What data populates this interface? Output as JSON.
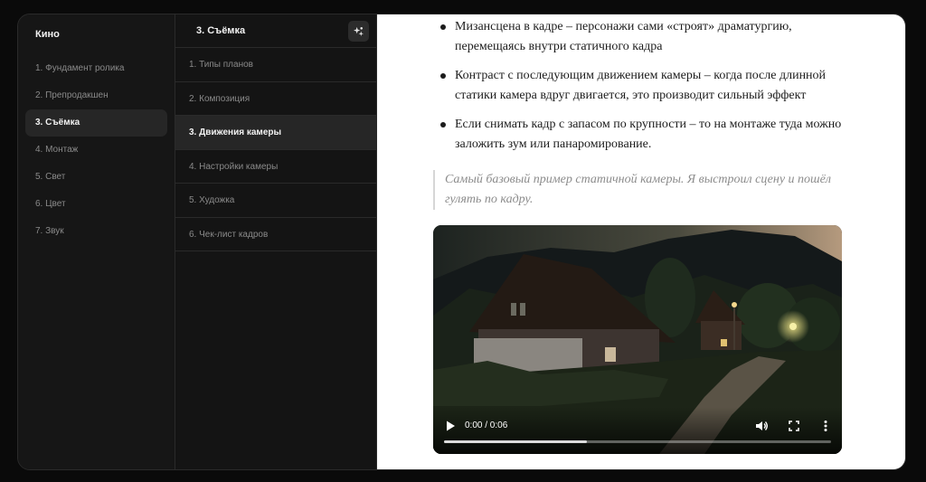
{
  "sidebar": {
    "title": "Кино",
    "items": [
      {
        "label": "1. Фундамент ролика",
        "active": false
      },
      {
        "label": "2. Препродакшен",
        "active": false
      },
      {
        "label": "3. Съёмка",
        "active": true
      },
      {
        "label": "4. Монтаж",
        "active": false
      },
      {
        "label": "5. Свет",
        "active": false
      },
      {
        "label": "6. Цвет",
        "active": false
      },
      {
        "label": "7. Звук",
        "active": false
      }
    ]
  },
  "chapters": {
    "title": "3. Съёмка",
    "header_icon": "sparkle-icon",
    "items": [
      {
        "label": "1. Типы планов",
        "active": false
      },
      {
        "label": "2. Композиция",
        "active": false
      },
      {
        "label": "3. Движения камеры",
        "active": true
      },
      {
        "label": "4. Настройки камеры",
        "active": false
      },
      {
        "label": "5. Художка",
        "active": false
      },
      {
        "label": "6. Чек-лист кадров",
        "active": false
      }
    ]
  },
  "content": {
    "bullets": [
      "Мизансцена в кадре – персонажи сами «строят» драматургию, перемещаясь внутри статичного кадра",
      "Контраст с последующим движением камеры – когда после длинной статики камера вдруг двигается, это производит сильный эффект",
      "Если снимать кадр с запасом по крупности – то на монтаже туда можно заложить зум или панаромирование."
    ],
    "quote": "Самый базовый пример статичной камеры. Я выстроил сцену и пошёл гулять по кадру.",
    "video": {
      "time": "0:00 / 0:06",
      "progress": 0.37
    }
  },
  "colors": {
    "background": "#0a0a0a",
    "panel": "#161616",
    "active_item": "#262626",
    "content_bg": "#ffffff",
    "quote_text": "#8c8c8c"
  }
}
